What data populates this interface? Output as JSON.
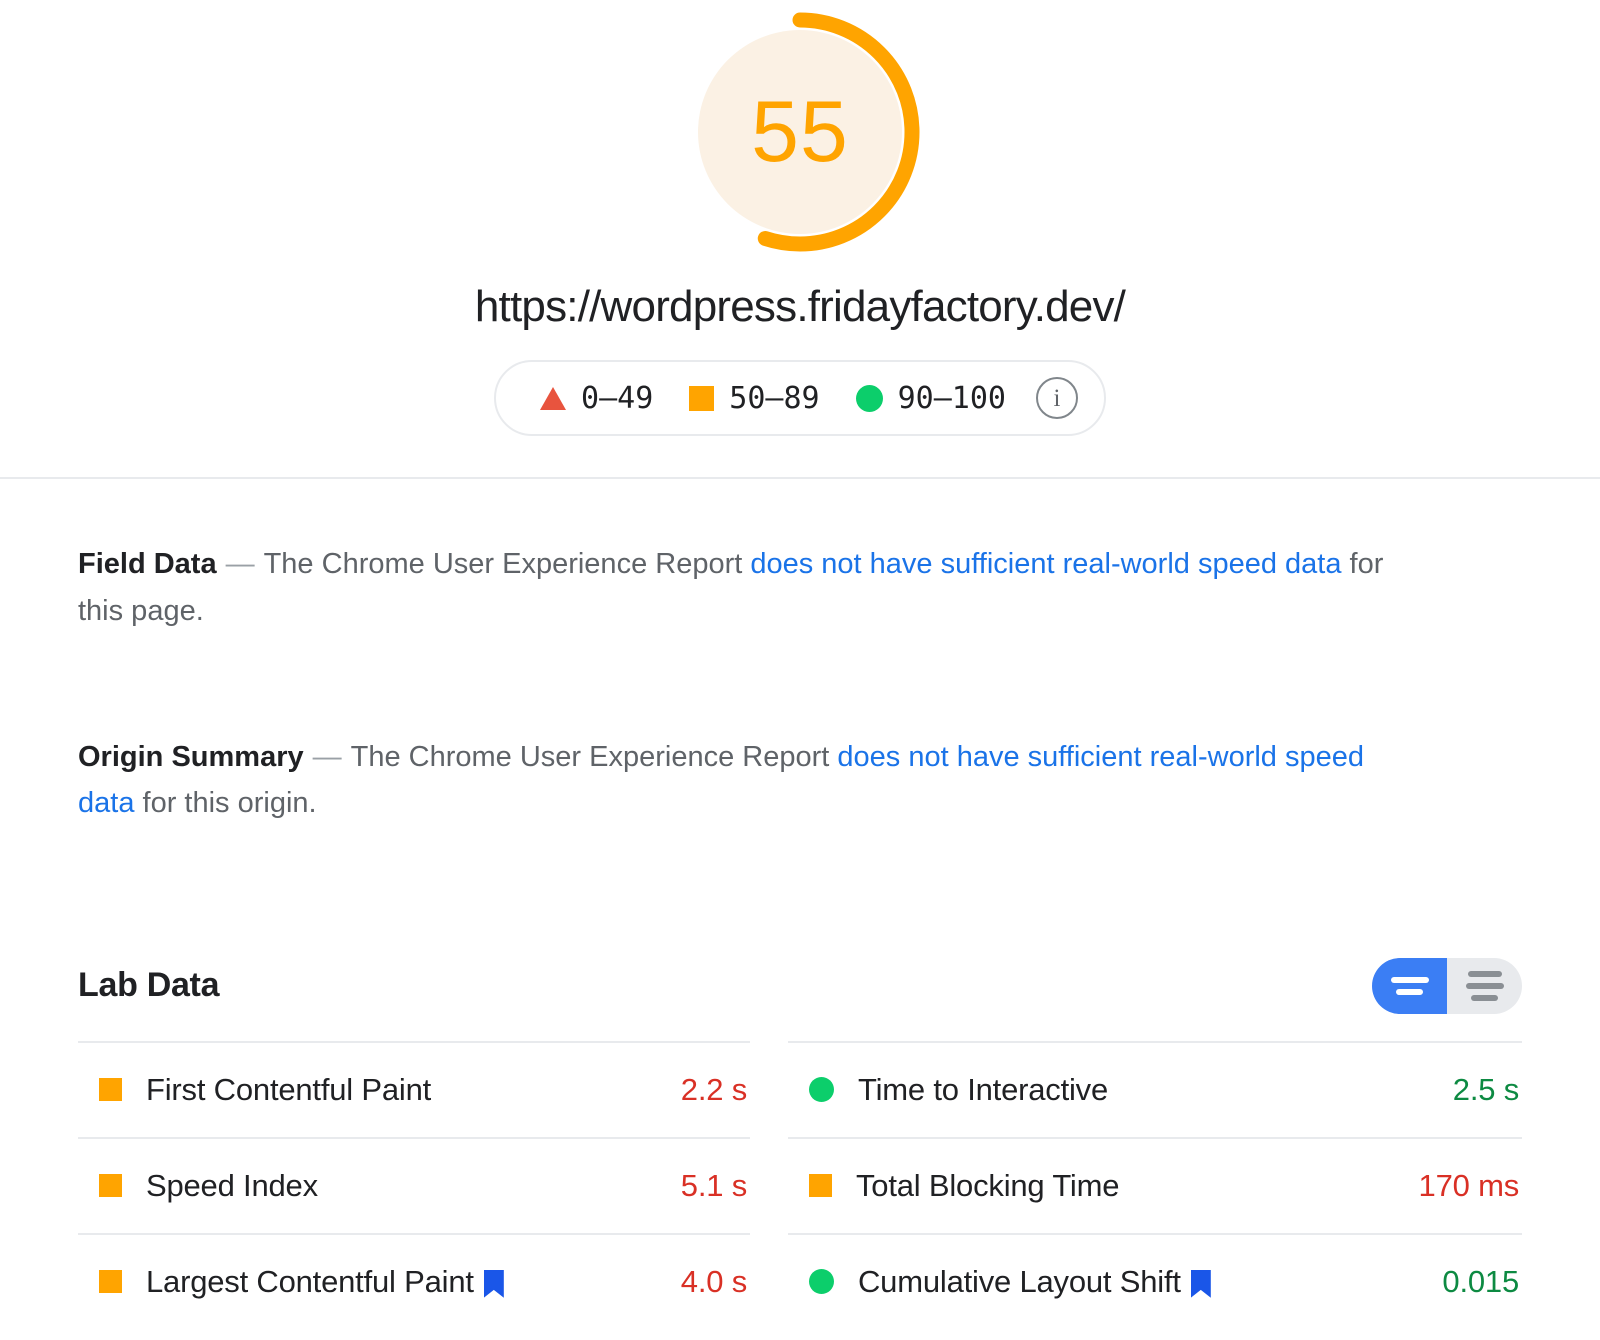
{
  "report": {
    "score": "55",
    "score_color": "#ffa400",
    "score_track_color": "#fbf1e4",
    "score_percent": 55,
    "url": "https://wordpress.fridayfactory.dev/"
  },
  "legend": {
    "items": [
      {
        "icon": "triangle-icon",
        "label": "0–49",
        "color": "#e8543e"
      },
      {
        "icon": "square-icon",
        "label": "50–89",
        "color": "#ffa400"
      },
      {
        "icon": "circle-icon",
        "label": "90–100",
        "color": "#0cce6b"
      }
    ],
    "info_glyph": "i",
    "info_icon": "info-icon"
  },
  "field_data": {
    "title": "Field Data",
    "dash": "—",
    "text_before": "The Chrome User Experience Report ",
    "link": "does not have sufficient real-world speed data",
    "text_after": " for this page."
  },
  "origin_summary": {
    "title": "Origin Summary",
    "dash": "—",
    "text_before": "The Chrome User Experience Report ",
    "link": "does not have sufficient real-world speed data",
    "text_after": " for this origin."
  },
  "lab_data": {
    "title": "Lab Data",
    "view_toggle": {
      "compact_label": "compact-view-icon",
      "expanded_label": "expanded-view-icon",
      "active": "compact"
    },
    "left_column": [
      {
        "status": "square",
        "name": "First Contentful Paint",
        "bookmark": false,
        "value": "2.2 s",
        "value_tone": "orange"
      },
      {
        "status": "square",
        "name": "Speed Index",
        "bookmark": false,
        "value": "5.1 s",
        "value_tone": "orange"
      },
      {
        "status": "square",
        "name": "Largest Contentful Paint",
        "bookmark": true,
        "value": "4.0 s",
        "value_tone": "orange"
      }
    ],
    "right_column": [
      {
        "status": "circle",
        "name": "Time to Interactive",
        "bookmark": false,
        "value": "2.5 s",
        "value_tone": "green"
      },
      {
        "status": "square",
        "name": "Total Blocking Time",
        "bookmark": false,
        "value": "170 ms",
        "value_tone": "orange"
      },
      {
        "status": "circle",
        "name": "Cumulative Layout Shift",
        "bookmark": true,
        "value": "0.015",
        "value_tone": "green"
      }
    ]
  },
  "colors": {
    "orange": "#ffa400",
    "green": "#0cce6b",
    "red": "#e8543e",
    "link_blue": "#1a73e8",
    "toggle_blue": "#3b7ef4",
    "bookmark_blue": "#1a56e8"
  }
}
